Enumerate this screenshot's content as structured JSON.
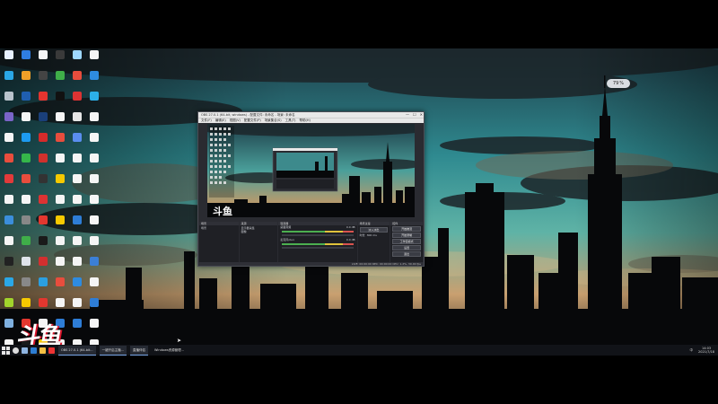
{
  "desktop": {
    "icons": [
      {
        "label": "",
        "color": "#e8f0ff"
      },
      {
        "label": "",
        "color": "#2f7de1"
      },
      {
        "label": "",
        "color": "#f5f5f5"
      },
      {
        "label": "",
        "color": "#3a3a3a"
      },
      {
        "label": "",
        "color": "#9ed8ff"
      },
      {
        "label": "",
        "color": "#f5f5f5"
      },
      {
        "label": "",
        "color": "#2aa7e6"
      },
      {
        "label": "",
        "color": "#f0a028"
      },
      {
        "label": "",
        "color": "#444"
      },
      {
        "label": "",
        "color": "#3fae49"
      },
      {
        "label": "",
        "color": "#e84d3d"
      },
      {
        "label": "",
        "color": "#2e8be0"
      },
      {
        "label": "",
        "color": "#b9c3cc"
      },
      {
        "label": "",
        "color": "#1f5fb0"
      },
      {
        "label": "",
        "color": "#e3342f"
      },
      {
        "label": "",
        "color": "#111"
      },
      {
        "label": "",
        "color": "#d33"
      },
      {
        "label": "",
        "color": "#2cb0e8"
      },
      {
        "label": "",
        "color": "#7a64c8"
      },
      {
        "label": "",
        "color": "#f5f5f5"
      },
      {
        "label": "",
        "color": "#1a3f7a"
      },
      {
        "label": "",
        "color": "#f5f5f5"
      },
      {
        "label": "",
        "color": "#e6e6e6"
      },
      {
        "label": "",
        "color": "#f5f5f5"
      },
      {
        "label": "",
        "color": "#f5f5f5"
      },
      {
        "label": "",
        "color": "#1d9bf0"
      },
      {
        "label": "",
        "color": "#d52b2b"
      },
      {
        "label": "",
        "color": "#e84d3d"
      },
      {
        "label": "",
        "color": "#5a8ef0"
      },
      {
        "label": "",
        "color": "#f5f5f5"
      },
      {
        "label": "",
        "color": "#e84d3d"
      },
      {
        "label": "",
        "color": "#35b64a"
      },
      {
        "label": "",
        "color": "#d0312d"
      },
      {
        "label": "",
        "color": "#f5f5f5"
      },
      {
        "label": "",
        "color": "#f5f5f5"
      },
      {
        "label": "",
        "color": "#f5f5f5"
      },
      {
        "label": "",
        "color": "#e23a3a"
      },
      {
        "label": "",
        "color": "#e84d3d"
      },
      {
        "label": "",
        "color": "#333"
      },
      {
        "label": "",
        "color": "#f6c900"
      },
      {
        "label": "",
        "color": "#f5f5f5"
      },
      {
        "label": "",
        "color": "#f5f5f5"
      },
      {
        "label": "",
        "color": "#f5f5f5"
      },
      {
        "label": "",
        "color": "#f5f5f5"
      },
      {
        "label": "",
        "color": "#d33"
      },
      {
        "label": "",
        "color": "#f5f5f5"
      },
      {
        "label": "",
        "color": "#f5f5f5"
      },
      {
        "label": "",
        "color": "#f5f5f5"
      },
      {
        "label": "",
        "color": "#3b8edb"
      },
      {
        "label": "",
        "color": "#888"
      },
      {
        "label": "",
        "color": "#e2372f"
      },
      {
        "label": "",
        "color": "#f6c900"
      },
      {
        "label": "",
        "color": "#2e7dd6"
      },
      {
        "label": "",
        "color": "#f5f5f5"
      },
      {
        "label": "",
        "color": "#f5f5f5"
      },
      {
        "label": "",
        "color": "#3fae49"
      },
      {
        "label": "",
        "color": "#1a1a1a"
      },
      {
        "label": "",
        "color": "#f5f5f5"
      },
      {
        "label": "",
        "color": "#f5f5f5"
      },
      {
        "label": "",
        "color": "#f5f5f5"
      },
      {
        "label": "",
        "color": "#222"
      },
      {
        "label": "",
        "color": "#dfe4ea"
      },
      {
        "label": "",
        "color": "#d32f2f"
      },
      {
        "label": "",
        "color": "#f5f5f5"
      },
      {
        "label": "",
        "color": "#f5f5f5"
      },
      {
        "label": "",
        "color": "#3b7fd6"
      },
      {
        "label": "",
        "color": "#2aa7e6"
      },
      {
        "label": "",
        "color": "#888"
      },
      {
        "label": "",
        "color": "#2b9fe0"
      },
      {
        "label": "",
        "color": "#e84d3d"
      },
      {
        "label": "",
        "color": "#2e8be0"
      },
      {
        "label": "",
        "color": "#f5f5f5"
      },
      {
        "label": "",
        "color": "#a2d42c"
      },
      {
        "label": "",
        "color": "#f6c900"
      },
      {
        "label": "",
        "color": "#e2372f"
      },
      {
        "label": "",
        "color": "#f5f5f5"
      },
      {
        "label": "",
        "color": "#f5f5f5"
      },
      {
        "label": "",
        "color": "#2e7dd6"
      },
      {
        "label": "",
        "color": "#7fb0e0"
      },
      {
        "label": "",
        "color": "#e2372f"
      },
      {
        "label": "",
        "color": "#f5f5f5"
      },
      {
        "label": "",
        "color": "#2e7dd6"
      },
      {
        "label": "",
        "color": "#2e7dd6"
      },
      {
        "label": "",
        "color": "#f5f5f5"
      },
      {
        "label": "",
        "color": "#f5f5f5"
      },
      {
        "label": "",
        "color": "#1a1a1a"
      },
      {
        "label": "",
        "color": "#f6c900"
      },
      {
        "label": "",
        "color": "#f5f5f5"
      },
      {
        "label": "",
        "color": "#f5f5f5"
      },
      {
        "label": "",
        "color": "#f5f5f5"
      },
      {
        "label": "",
        "color": "#34b6d8"
      },
      {
        "label": "",
        "color": "#e2372f"
      },
      {
        "label": "",
        "color": "#555"
      },
      {
        "label": "",
        "color": "#f5f5f5"
      },
      {
        "label": "",
        "color": "#f5f5f5"
      },
      {
        "label": "",
        "color": "#f5f5f5"
      }
    ],
    "watermark_logo": "斗鱼"
  },
  "net_widget": {
    "value": "79",
    "unit": "%"
  },
  "obs": {
    "title": "OBS 27.0.1 (64-bit, windows) - 配置文件: 未命名 - 场景: 未命名",
    "window_buttons": [
      "—",
      "☐",
      "✕"
    ],
    "menu": [
      "文件(F)",
      "编辑(E)",
      "视图(V)",
      "配置文件(P)",
      "场景集合(S)",
      "工具(T)",
      "帮助(H)"
    ],
    "preview_logo": "斗鱼",
    "docks": {
      "scenes": {
        "title": "场景",
        "items": [
          "场景"
        ],
        "footer": "+ − ∧ ∨"
      },
      "sources": {
        "title": "来源",
        "items": [
          "显示器采集",
          "图像"
        ],
        "footer": "+ − ⚙ ∧ ∨"
      },
      "mixer": {
        "title": "混音器",
        "items": [
          "桌面音频",
          "麦克风/Aux"
        ],
        "db": "0.0 dB"
      },
      "transitions": {
        "title": "场景过渡",
        "fade": "淡入淡出",
        "duration_label": "时长",
        "duration": "300 ms"
      },
      "controls": {
        "title": "控件",
        "buttons": [
          "开始推流",
          "开始录制",
          "工作室模式",
          "设置",
          "退出"
        ]
      }
    },
    "status": "LIVE: 00:00:00  REC: 00:00:00  CPU: 1.2%, 30.00 fps"
  },
  "taskbar": {
    "tasks": [
      "OBS 27.0.1 (64-bit...",
      "一键开启主播...",
      "直播伴侣",
      "Windows资源管理..."
    ],
    "lang": "中",
    "time": "14:03",
    "date": "2021/7/18"
  }
}
